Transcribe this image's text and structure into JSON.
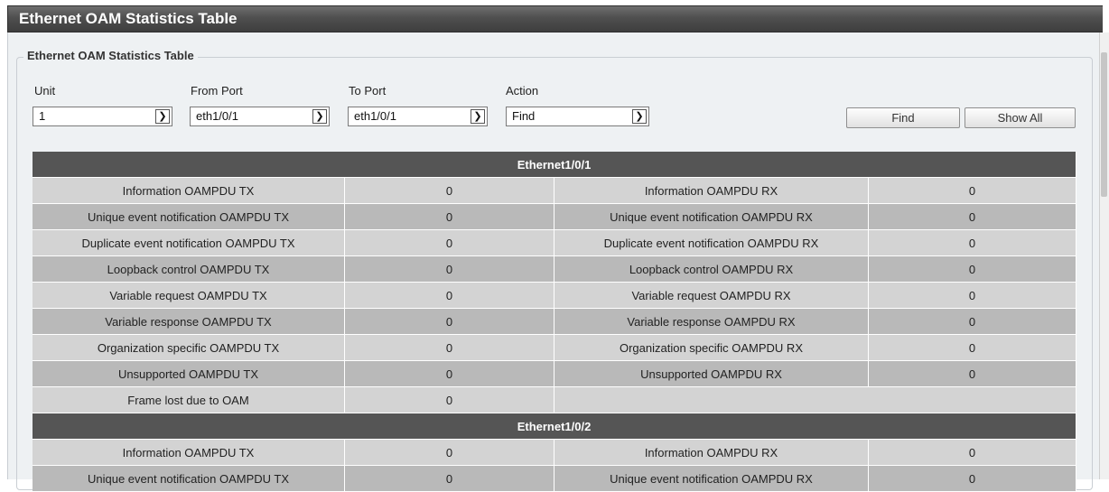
{
  "window": {
    "title": "Ethernet OAM Statistics Table"
  },
  "section": {
    "legend": "Ethernet OAM Statistics Table"
  },
  "filters": {
    "unit": {
      "label": "Unit",
      "value": "1"
    },
    "from_port": {
      "label": "From Port",
      "value": "eth1/0/1"
    },
    "to_port": {
      "label": "To Port",
      "value": "eth1/0/1"
    },
    "action": {
      "label": "Action",
      "value": "Find"
    }
  },
  "buttons": {
    "find": "Find",
    "show_all": "Show All"
  },
  "groups": [
    {
      "header": "Ethernet1/0/1",
      "rows": [
        {
          "tx_label": "Information OAMPDU TX",
          "tx_value": "0",
          "rx_label": "Information OAMPDU RX",
          "rx_value": "0"
        },
        {
          "tx_label": "Unique event notification OAMPDU TX",
          "tx_value": "0",
          "rx_label": "Unique event notification OAMPDU RX",
          "rx_value": "0"
        },
        {
          "tx_label": "Duplicate event notification OAMPDU TX",
          "tx_value": "0",
          "rx_label": "Duplicate event notification OAMPDU RX",
          "rx_value": "0"
        },
        {
          "tx_label": "Loopback control OAMPDU TX",
          "tx_value": "0",
          "rx_label": "Loopback control OAMPDU RX",
          "rx_value": "0"
        },
        {
          "tx_label": "Variable request OAMPDU TX",
          "tx_value": "0",
          "rx_label": "Variable request OAMPDU RX",
          "rx_value": "0"
        },
        {
          "tx_label": "Variable response OAMPDU TX",
          "tx_value": "0",
          "rx_label": "Variable response OAMPDU RX",
          "rx_value": "0"
        },
        {
          "tx_label": "Organization specific OAMPDU TX",
          "tx_value": "0",
          "rx_label": "Organization specific OAMPDU RX",
          "rx_value": "0"
        },
        {
          "tx_label": "Unsupported OAMPDU TX",
          "tx_value": "0",
          "rx_label": "Unsupported OAMPDU RX",
          "rx_value": "0"
        },
        {
          "tx_label": "Frame lost due to OAM",
          "tx_value": "0",
          "rx_label": "",
          "rx_value": ""
        }
      ]
    },
    {
      "header": "Ethernet1/0/2",
      "rows": [
        {
          "tx_label": "Information OAMPDU TX",
          "tx_value": "0",
          "rx_label": "Information OAMPDU RX",
          "rx_value": "0"
        },
        {
          "tx_label": "Unique event notification OAMPDU TX",
          "tx_value": "0",
          "rx_label": "Unique event notification OAMPDU RX",
          "rx_value": "0"
        }
      ]
    }
  ]
}
